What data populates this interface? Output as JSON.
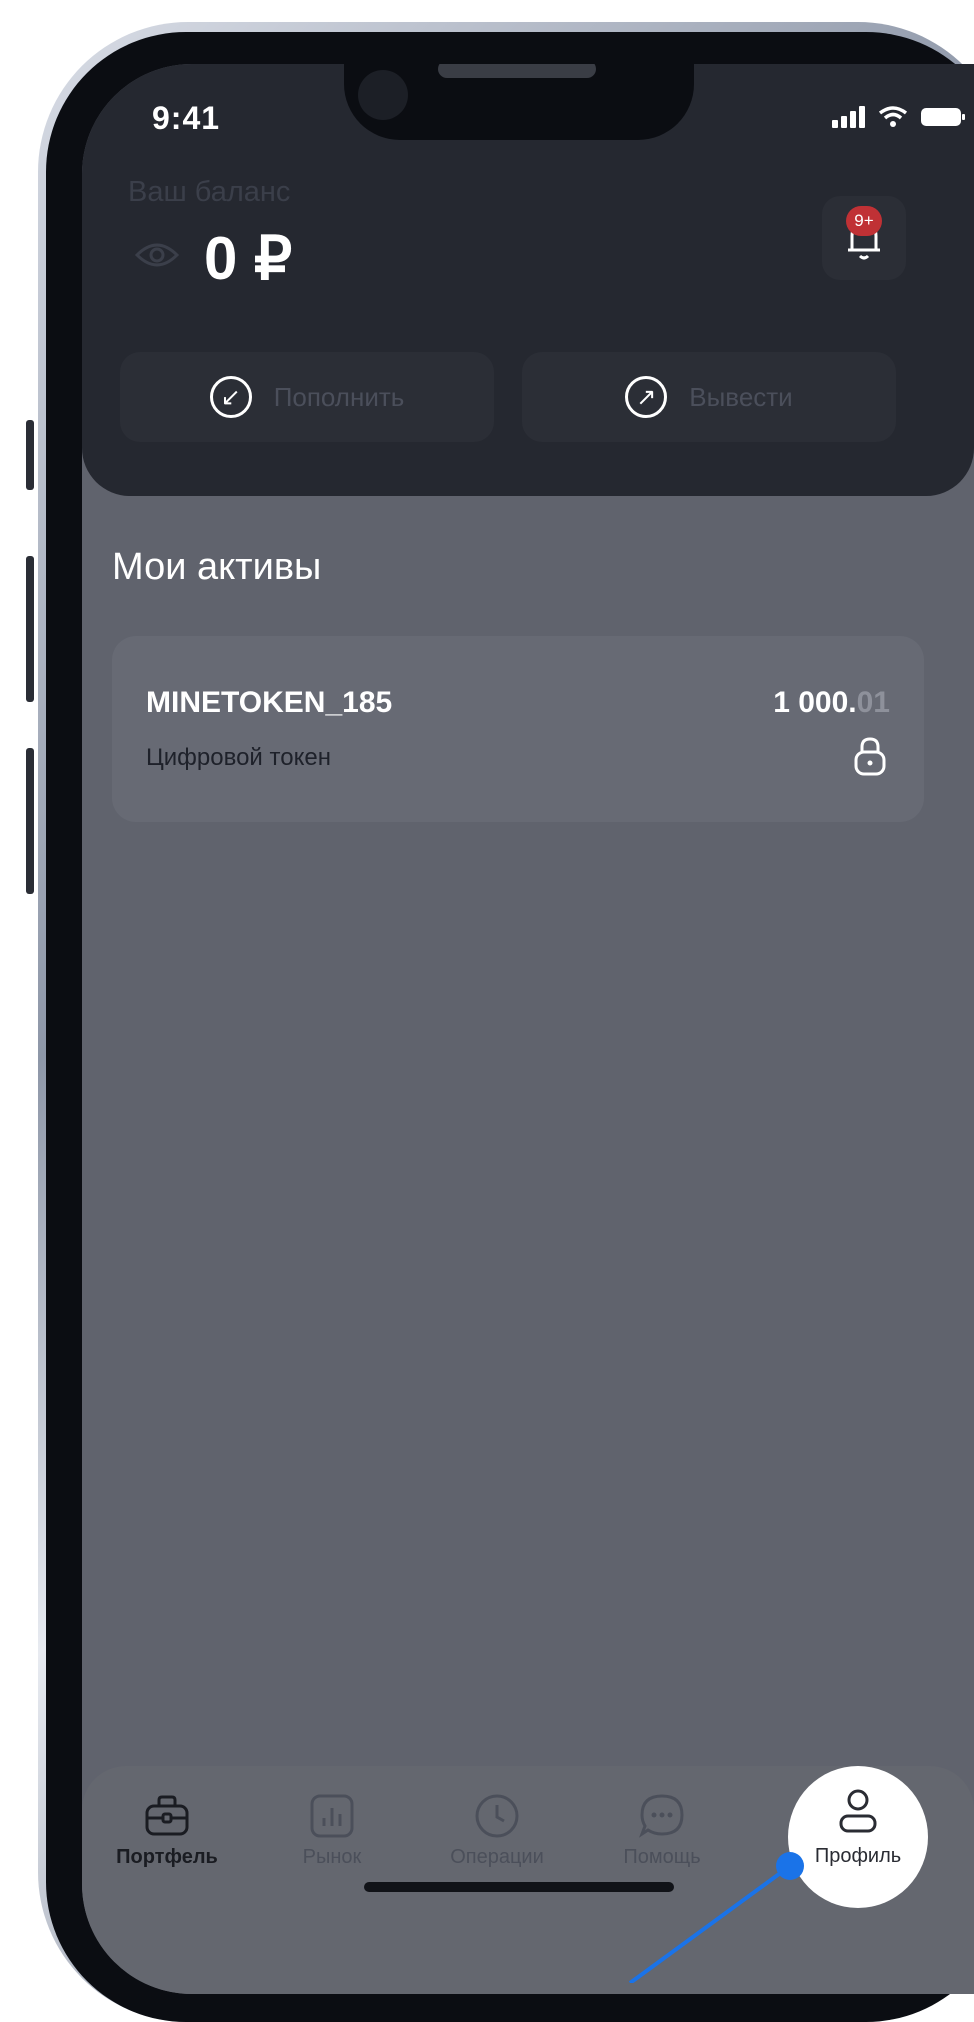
{
  "status_bar": {
    "time": "9:41"
  },
  "header": {
    "balance_label": "Ваш баланс",
    "balance_value": "0 ₽",
    "notification_badge": "9+",
    "deposit_label": "Пополнить",
    "withdraw_label": "Вывести"
  },
  "assets": {
    "title": "Мои активы",
    "items": [
      {
        "name": "MINETOKEN_185",
        "type": "Цифровой токен",
        "amount_int": "1 000.",
        "amount_dec": "01"
      }
    ]
  },
  "tabbar": {
    "items": [
      {
        "label": "Портфель",
        "icon": "briefcase-icon",
        "active": true
      },
      {
        "label": "Рынок",
        "icon": "chart-icon",
        "active": false
      },
      {
        "label": "Операции",
        "icon": "clock-icon",
        "active": false
      },
      {
        "label": "Помощь",
        "icon": "chat-icon",
        "active": false
      },
      {
        "label": "Профиль",
        "icon": "user-icon",
        "active": false
      }
    ]
  },
  "colors": {
    "overlay": "#60636d",
    "header_bg": "#252830",
    "badge": "#c03135",
    "pointer": "#1a73e8"
  }
}
